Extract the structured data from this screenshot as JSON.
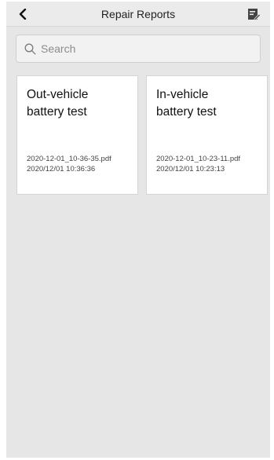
{
  "header": {
    "title": "Repair Reports",
    "back_icon": "chevron-left-icon",
    "edit_icon": "edit-list-icon"
  },
  "search": {
    "placeholder": "Search",
    "value": "",
    "icon": "search-icon"
  },
  "reports": [
    {
      "title_line1": "Out-vehicle",
      "title_line2": "battery test",
      "file": "2020-12-01_10-36-35.pdf",
      "date": "2020/12/01 10:36:36"
    },
    {
      "title_line1": "In-vehicle",
      "title_line2": "battery test",
      "file": "2020-12-01_10-23-11.pdf",
      "date": "2020/12/01 10:23:13"
    }
  ],
  "colors": {
    "background": "#e6e6e6",
    "card": "#ffffff",
    "text": "#111111"
  }
}
